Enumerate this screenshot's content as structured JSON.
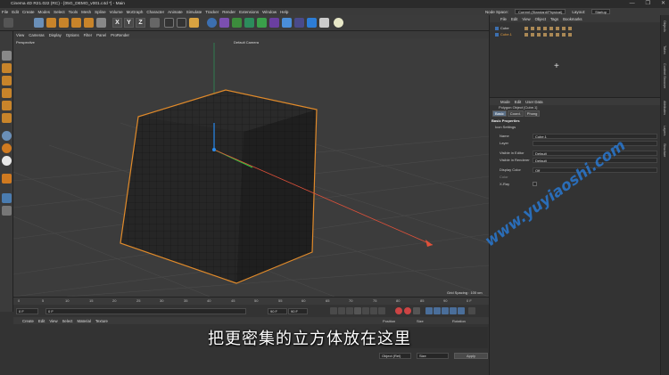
{
  "window": {
    "title": "Cinema 4D R21.022 (RC) - [05G_DEMO_v001.c4d *] - Main",
    "controls": [
      "—",
      "❐",
      "✕"
    ]
  },
  "menubar": {
    "items": [
      "File",
      "Edit",
      "Create",
      "Modes",
      "Select",
      "Tools",
      "Mesh",
      "Spline",
      "Volume",
      "MoGraph",
      "Character",
      "Animate",
      "Simulate",
      "Tracker",
      "Render",
      "Extensions",
      "Window",
      "Help"
    ],
    "node_space_label": "Node Space:",
    "node_space_value": "Current (Standard/Physical)",
    "layout_label": "Layout:",
    "layout_value": "Startup"
  },
  "toolbar": {
    "axis_letters": [
      "X",
      "Y",
      "Z"
    ]
  },
  "viewport": {
    "menu": [
      "View",
      "Cameras",
      "Display",
      "Options",
      "Filter",
      "Panel",
      "ProRender"
    ],
    "projection": "Perspective",
    "camera": "Default Camera",
    "grid_spacing": "Grid Spacing : 100 cm"
  },
  "timeline": {
    "ticks": [
      "0",
      "5",
      "10",
      "15",
      "20",
      "25",
      "30",
      "35",
      "40",
      "45",
      "50",
      "55",
      "60",
      "65",
      "70",
      "75",
      "80",
      "85",
      "90"
    ],
    "end_frame_label": "0 F"
  },
  "playback": {
    "start_frame": "0 F",
    "current_frame": "0 F",
    "end_frame": "90 F",
    "max_frame": "90 F"
  },
  "materials": {
    "menu": [
      "Create",
      "Edit",
      "View",
      "Select",
      "Material",
      "Texture"
    ]
  },
  "coordinates": {
    "headers": [
      "Position",
      "Size",
      "Rotation"
    ],
    "mode_dropdown": "Object (Rel)",
    "size_dropdown": "Size",
    "apply_label": "Apply"
  },
  "object_manager": {
    "menu": [
      "File",
      "Edit",
      "View",
      "Object",
      "Tags",
      "Bookmarks"
    ],
    "objects": [
      {
        "name": "Cube"
      },
      {
        "name": "Cube.1"
      }
    ]
  },
  "attributes": {
    "menu": [
      "Mode",
      "Edit",
      "User Data"
    ],
    "object_title": "Polygon Object [Cube.1]",
    "tabs": [
      {
        "label": "Basic",
        "active": true
      },
      {
        "label": "Coord.",
        "active": false
      },
      {
        "label": "Phong",
        "active": false
      }
    ],
    "section_title": "Basic Properties",
    "subsection": "Icon Settings",
    "props": [
      {
        "label": "Name",
        "value": "Cube.1"
      },
      {
        "label": "Layer",
        "value": ""
      },
      {
        "label": "Visible in Editor",
        "value": "Default"
      },
      {
        "label": "Visible in Renderer",
        "value": "Default"
      },
      {
        "label": "Display Color",
        "value": "Off"
      },
      {
        "label": "Color",
        "value": ""
      },
      {
        "label": "X-Ray",
        "value": ""
      }
    ]
  },
  "side_tabs": [
    "Objects",
    "Takes",
    "Content Browser",
    "Attributes",
    "Layers",
    "Structure"
  ],
  "subtitle": "把更密集的立方体放在这里",
  "watermark": "www.yuyiaoshi.com"
}
